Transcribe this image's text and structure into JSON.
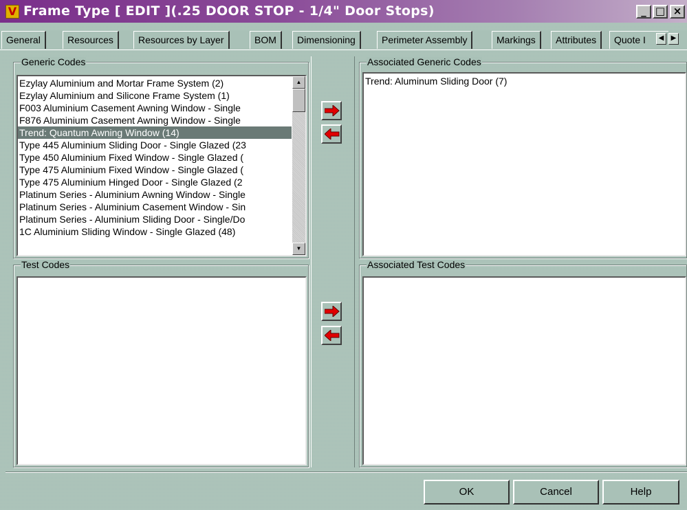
{
  "window": {
    "title": "Frame Type  [ EDIT ](.25 DOOR STOP - 1/4\" Door Stops)",
    "app_icon_glyph": "V",
    "controls": {
      "minimize_icon": "minimize-icon",
      "maximize_icon": "maximize-icon",
      "close_icon": "close-icon"
    }
  },
  "tabs": [
    {
      "label": "General"
    },
    {
      "label": "Resources"
    },
    {
      "label": "Resources by Layer"
    },
    {
      "label": "BOM"
    },
    {
      "label": "Dimensioning"
    },
    {
      "label": "Perimeter Assembly"
    },
    {
      "label": "Markings"
    },
    {
      "label": "Attributes"
    },
    {
      "label": "Quote I"
    }
  ],
  "generic_codes": {
    "label": "Generic Codes",
    "items": [
      "Ezylay Aluminium and Mortar Frame System (2)",
      "Ezylay Aluminium and Silicone Frame System (1)",
      "F003 Aluminium Casement Awning Window - Single",
      "F876 Aluminium Casement Awning Window - Single",
      "Trend: Quantum  Awning Window (14)",
      "Type 445 Aluminium Sliding Door - Single Glazed (23",
      "Type 450 Aluminium Fixed Window - Single Glazed (",
      "Type 475 Aluminium Fixed Window - Single Glazed (",
      "Type 475 Aluminium Hinged Door - Single Glazed (2",
      "Platinum Series - Aluminium Awning Window - Single",
      "Platinum Series - Aluminium Casement Window - Sin",
      "Platinum Series - Aluminium Sliding Door - Single/Do",
      "1C Aluminium Sliding Window - Single Glazed (48)"
    ],
    "selected_index": 4
  },
  "associated_generic_codes": {
    "label": "Associated Generic Codes",
    "items": [
      "Trend: Aluminum Sliding Door (7)"
    ]
  },
  "test_codes": {
    "label": "Test Codes",
    "items": []
  },
  "associated_test_codes": {
    "label": "Associated Test Codes",
    "items": []
  },
  "buttons": {
    "ok": "OK",
    "cancel": "Cancel",
    "help": "Help"
  },
  "colors": {
    "dialog_bg": "#a9c1b7",
    "title_start": "#7a2f8a",
    "selection": "#6a7a76",
    "arrow_red": "#e00000"
  }
}
